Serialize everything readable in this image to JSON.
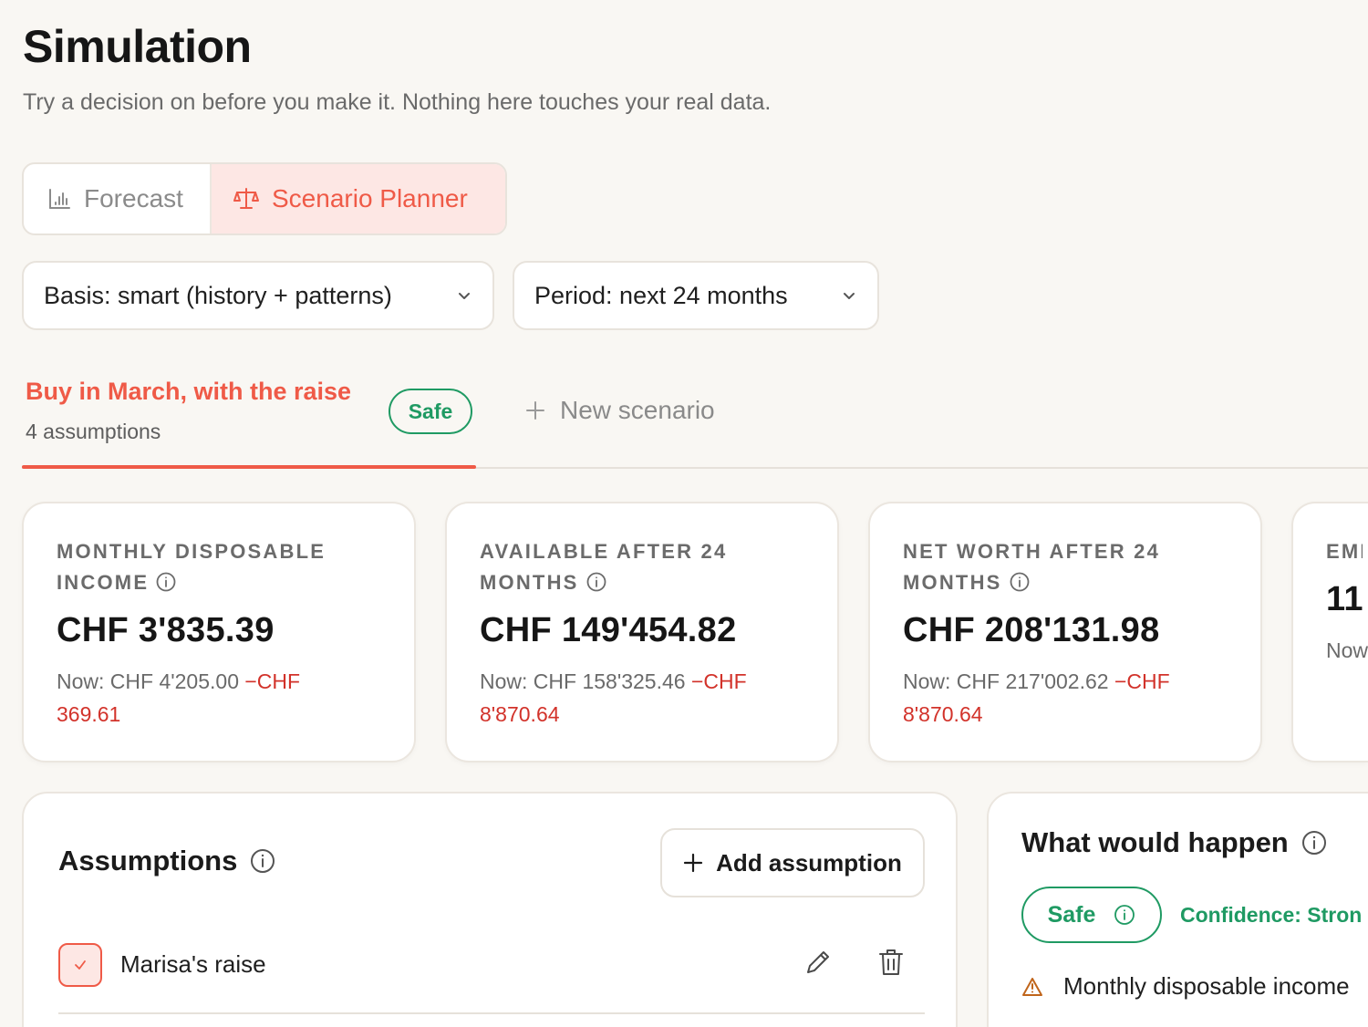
{
  "header": {
    "title": "Simulation",
    "subtitle": "Try a decision on before you make it. Nothing here touches your real data."
  },
  "view_tabs": {
    "forecast": "Forecast",
    "planner": "Scenario Planner",
    "active": "planner"
  },
  "controls": {
    "basis": "Basis: smart (history + patterns)",
    "period": "Period: next 24 months"
  },
  "scenario": {
    "name": "Buy in March, with the raise",
    "meta": "4 assumptions",
    "badge": "Safe",
    "new_label": "New scenario"
  },
  "metrics": [
    {
      "label": "Monthly disposable income",
      "value": "CHF 3'835.39",
      "now": "Now: CHF 4'205.00",
      "delta": "−CHF 369.61"
    },
    {
      "label": "Available after 24 months",
      "value": "CHF 149'454.82",
      "now": "Now: CHF 158'325.46",
      "delta": "−CHF 8'870.64"
    },
    {
      "label": "Net worth after 24 months",
      "value": "CHF 208'131.98",
      "now": "Now: CHF 217'002.62",
      "delta": "−CHF 8'870.64"
    },
    {
      "label": "EME LOW",
      "value": "11",
      "now": "Now",
      "delta": ""
    }
  ],
  "assumptions": {
    "title": "Assumptions",
    "add_label": "Add assumption",
    "items": [
      {
        "label": "Marisa's raise",
        "checked": true
      }
    ]
  },
  "outcome": {
    "title": "What would happen",
    "status": "Safe",
    "confidence": "Confidence: Stron",
    "warning": "Monthly disposable income"
  },
  "colors": {
    "accent": "#ef5a47",
    "safe": "#1f9a63",
    "negative": "#d2322a",
    "warning": "#c0651b"
  }
}
